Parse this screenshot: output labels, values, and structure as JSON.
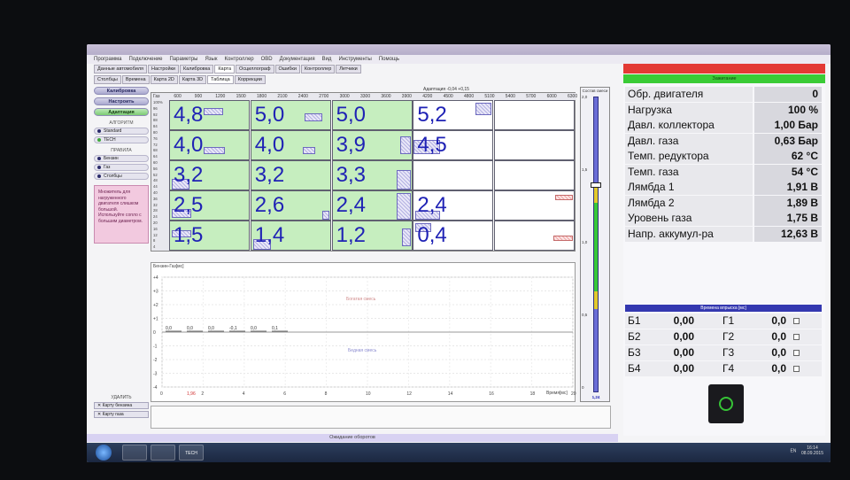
{
  "menu": [
    "Программа",
    "Подключение",
    "Параметры",
    "Язык",
    "Контроллер",
    "OBD",
    "Документация",
    "Вид",
    "Инструменты",
    "Помощь"
  ],
  "tabs_top": [
    {
      "label": "Данные автомобиля",
      "active": false
    },
    {
      "label": "Настройки",
      "active": false
    },
    {
      "label": "Калибровка",
      "active": false
    },
    {
      "label": "Карта",
      "active": true
    },
    {
      "label": "Осциллограф",
      "active": false
    },
    {
      "label": "Ошибки",
      "active": false
    },
    {
      "label": "Контроллер",
      "active": false
    },
    {
      "label": "Летчики",
      "active": false
    }
  ],
  "tabs_sub": [
    {
      "label": "Столбцы",
      "active": false
    },
    {
      "label": "Времена",
      "active": false
    },
    {
      "label": "Карта 2D",
      "active": false
    },
    {
      "label": "Карта 3D",
      "active": false
    },
    {
      "label": "Таблица",
      "active": true
    },
    {
      "label": "Коррекции",
      "active": false
    }
  ],
  "left_panel": {
    "btn_calibration": "Калибровка",
    "btn_setup": "Настроить",
    "btn_adaptation": "Адаптация",
    "algorithm_title": "АЛГОРИТМ",
    "algorithm_options": [
      "Standard",
      "TECH"
    ],
    "rules_title": "ПРАВИЛА",
    "rule_options": [
      "Бензин",
      "Газ",
      "Столбцы"
    ],
    "note": "Множитель для нагруженного двигателя слишком большой. Используйте сопло с большим диаметром."
  },
  "map_table": {
    "adaptation_header": "Адаптация   -0,04   +0,15",
    "rpm_header": [
      "Газ",
      "600",
      "900",
      "1200",
      "1500",
      "1800",
      "2100",
      "2400",
      "2700",
      "3000",
      "3300",
      "3600",
      "3900",
      "4200",
      "4500",
      "4800",
      "5100",
      "5400",
      "5700",
      "6000",
      "6300"
    ],
    "load_labels": [
      "100%",
      "96",
      "92",
      "88",
      "84",
      "80",
      "76",
      "72",
      "68",
      "64",
      "60",
      "56",
      "52",
      "48",
      "44",
      "40",
      "36",
      "32",
      "28",
      "24",
      "20",
      "16",
      "12",
      "8",
      "4"
    ],
    "rows": [
      [
        "4,8",
        "5,0",
        "5,0",
        "5,2",
        ""
      ],
      [
        "4,0",
        "4,0",
        "3,9",
        "4,5",
        ""
      ],
      [
        "3,2",
        "3,2",
        "3,3",
        "",
        ""
      ],
      [
        "2,5",
        "2,6",
        "2,4",
        "2,4",
        ""
      ],
      [
        "1,5",
        "1,4",
        "1,2",
        "0,4",
        ""
      ]
    ],
    "filled": [
      [
        true,
        true,
        true,
        false,
        false
      ],
      [
        true,
        true,
        true,
        false,
        false
      ],
      [
        true,
        true,
        true,
        false,
        false
      ],
      [
        true,
        true,
        true,
        false,
        false
      ],
      [
        true,
        true,
        true,
        false,
        false
      ]
    ]
  },
  "gauge": {
    "title": "Состав смеси",
    "ticks": [
      "2,0",
      "1,5",
      "1,0",
      "0,5",
      "0"
    ],
    "value": "1,24",
    "level": 0.62
  },
  "chart": {
    "title": "Бензин-Газ[мс]",
    "upper_label": "Богатая смесь",
    "lower_label": "Бедная смесь",
    "y_ticks": [
      "+4",
      "+3",
      "+2",
      "+1",
      "0",
      "-1",
      "-2",
      "-3",
      "-4"
    ],
    "x_ticks": [
      "0",
      "2",
      "4",
      "6",
      "8",
      "10",
      "12",
      "14",
      "16",
      "18",
      "20"
    ],
    "x_label": "Время[мс]",
    "marker_label": "1,96",
    "point_labels": [
      "0,0",
      "0,0",
      "0,0",
      "-0,1",
      "0,0",
      "0,1"
    ]
  },
  "delete_block": {
    "title": "УДАЛИТЬ",
    "btn_petrol_map": "Карту бензина",
    "btn_gas_map": "Карту газа"
  },
  "status": "Ожидание оборотов",
  "right_panel": {
    "header": "Зажигание",
    "params": [
      {
        "label": "Обр. двигателя",
        "value": "0"
      },
      {
        "label": "Нагрузка",
        "value": "100 %"
      },
      {
        "label": "Давл. коллектора",
        "value": "1,00 Бар"
      },
      {
        "label": "Давл. газа",
        "value": "0,63 Бар"
      },
      {
        "label": "Темп. редуктора",
        "value": "62 °C"
      },
      {
        "label": "Темп. газа",
        "value": "54 °C"
      },
      {
        "label": "Лямбда 1",
        "value": "1,91 В"
      },
      {
        "label": "Лямбда 2",
        "value": "1,89 В"
      },
      {
        "label": "Уровень газа",
        "value": "1,75 В"
      },
      {
        "label": "Напр. аккумул-ра",
        "value": "12,63 В"
      }
    ],
    "injection_header": "Времена впрыска [мс]",
    "injection": [
      {
        "b": "Б1",
        "bv": "0,00",
        "g": "Г1",
        "gv": "0,0"
      },
      {
        "b": "Б2",
        "bv": "0,00",
        "g": "Г2",
        "gv": "0,0"
      },
      {
        "b": "Б3",
        "bv": "0,00",
        "g": "Г3",
        "gv": "0,0"
      },
      {
        "b": "Б4",
        "bv": "0,00",
        "g": "Г4",
        "gv": "0,0"
      }
    ]
  },
  "taskbar": {
    "app_label": "TECH",
    "lang": "EN",
    "time": "16:14",
    "date": "08.09.2015"
  },
  "colors": {
    "cell_filled": "#c6eebf",
    "value_text": "#1f22b5",
    "ignition_red": "#e33a34",
    "ignition_green": "#3acb36"
  }
}
